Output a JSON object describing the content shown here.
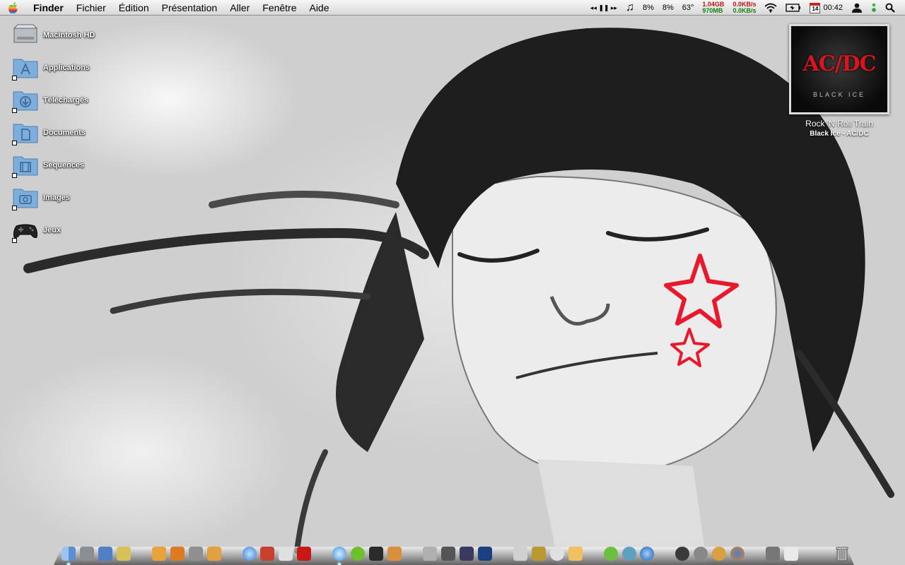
{
  "menubar": {
    "app_name": "Finder",
    "menus": [
      "Fichier",
      "Édition",
      "Présentation",
      "Aller",
      "Fenêtre",
      "Aide"
    ],
    "status": {
      "cpu1": "8%",
      "cpu2": "8%",
      "temperature": "63°",
      "memory_used": "1.04GB",
      "memory_free": "970MB",
      "net_up": "0.0KB/s",
      "net_down": "0.0KB/s",
      "calendar_day": "14",
      "clock": "00:42"
    },
    "icons": [
      "playback-controls-icon",
      "itunes-note-icon",
      "wifi-icon",
      "battery-icon",
      "calendar-icon",
      "user-icon",
      "status-light-icon",
      "spotlight-icon"
    ]
  },
  "desktop": {
    "icons": [
      {
        "label": "Macintosh HD",
        "icon": "hard-drive-icon"
      },
      {
        "label": "Applications",
        "icon": "applications-folder-icon"
      },
      {
        "label": "Téléchargés",
        "icon": "downloads-folder-icon"
      },
      {
        "label": "Documents",
        "icon": "documents-folder-icon"
      },
      {
        "label": "Séquences",
        "icon": "movies-folder-icon"
      },
      {
        "label": "Images",
        "icon": "pictures-folder-icon"
      },
      {
        "label": "Jeux",
        "icon": "gamepad-icon"
      }
    ]
  },
  "now_playing": {
    "album_logo": "AC/DC",
    "album_subtitle": "BLACK ICE",
    "track": "Rock 'N Roll Train",
    "album_artist": "Black Ice - AC/DC"
  },
  "dock": {
    "colors": {
      "finder": "#5a8fd6",
      "itunes": "#3b8fe0",
      "spotify": "#6cbf2d",
      "photoshop": "#1c3f80",
      "trash": "#9a9a9a"
    }
  }
}
